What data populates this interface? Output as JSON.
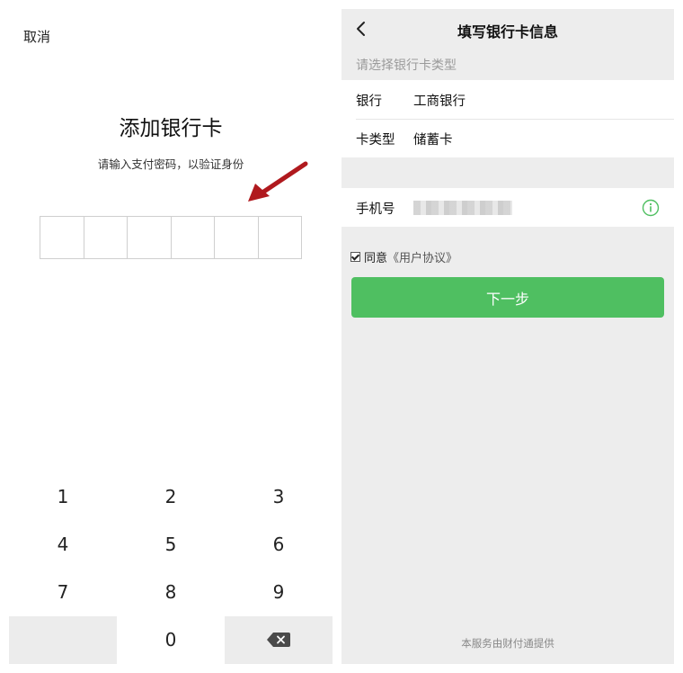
{
  "left": {
    "cancel_label": "取消",
    "title": "添加银行卡",
    "subtitle": "请输入支付密码，以验证身份",
    "pin_cells": 6,
    "keypad": {
      "keys": [
        "1",
        "2",
        "3",
        "4",
        "5",
        "6",
        "7",
        "8",
        "9",
        "",
        "0",
        "delete"
      ]
    },
    "arrow_color": "#b0191e"
  },
  "right": {
    "nav_title": "填写银行卡信息",
    "select_hint": "请选择银行卡类型",
    "bank_label": "银行",
    "bank_value": "工商银行",
    "card_type_label": "卡类型",
    "card_type_value": "储蓄卡",
    "phone_label": "手机号",
    "agree_text": "同意",
    "agreement_link": "《用户协议》",
    "agree_checked": true,
    "next_button": "下一步",
    "footer": "本服务由财付通提供",
    "accent_color": "#4fbf61"
  }
}
